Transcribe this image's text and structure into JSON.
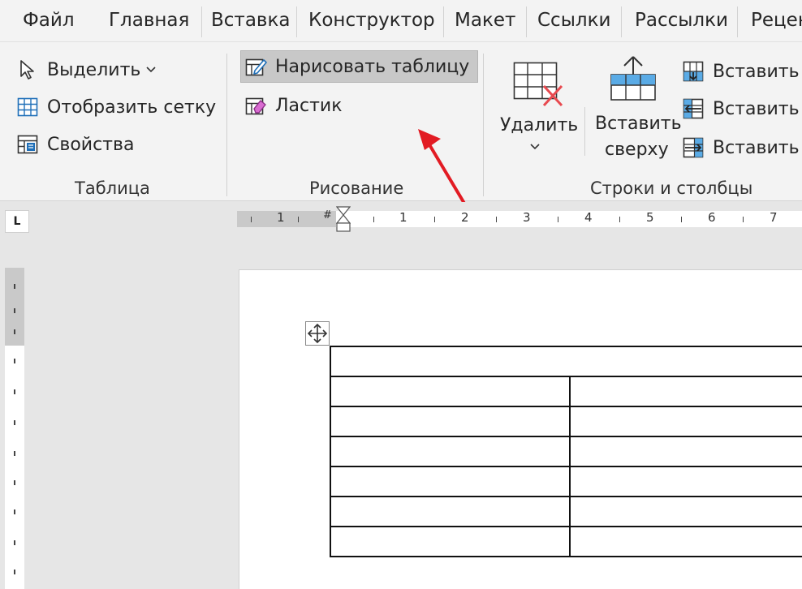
{
  "tabs": [
    "Файл",
    "Главная",
    "Вставка",
    "Конструктор",
    "Макет",
    "Ссылки",
    "Рассылки",
    "Рецен"
  ],
  "ribbon": {
    "table_group": {
      "label": "Таблица",
      "select": "Выделить",
      "show_grid": "Отобразить сетку",
      "properties": "Свойства"
    },
    "draw_group": {
      "label": "Рисование",
      "draw_table": "Нарисовать таблицу",
      "eraser": "Ластик"
    },
    "rows_group": {
      "label": "Строки и столбцы",
      "delete": "Удалить",
      "insert_above_line1": "Вставить",
      "insert_above_line2": "сверху",
      "insert_below": "Вставить с",
      "insert_left": "Вставить с",
      "insert_right": "Вставить с"
    }
  },
  "ruler": {
    "tab_stop": "L",
    "labels": [
      "1",
      "1",
      "2",
      "3",
      "4",
      "5",
      "6",
      "7"
    ]
  },
  "colors": {
    "accent_blue": "#1f6fb8",
    "arrow_red": "#e21b23",
    "delete_x": "#e8494f"
  }
}
